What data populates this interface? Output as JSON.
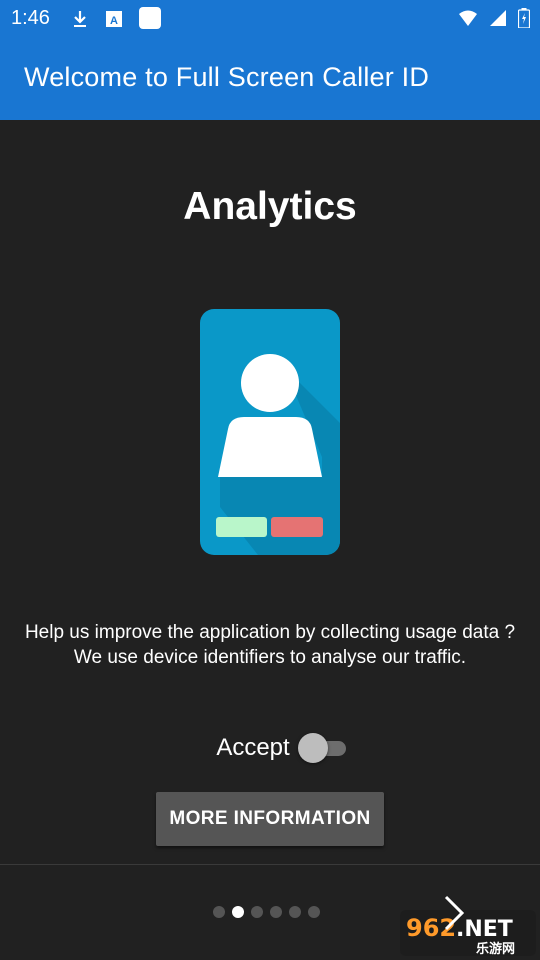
{
  "status_bar": {
    "time": "1:46",
    "icons": [
      "download-icon",
      "a-notification-icon",
      "app-square-icon",
      "wifi-icon",
      "cell-signal-icon",
      "battery-icon"
    ]
  },
  "app_bar": {
    "title": "Welcome to Full Screen Caller ID",
    "color": "#1976d2"
  },
  "onboarding": {
    "title": "Analytics",
    "illustration": "phone-caller-illustration",
    "description": "Help us improve the application by collecting usage data ? We use device identifiers to analyse our traffic.",
    "accept_label": "Accept",
    "accept_toggle_on": false,
    "more_info_label": "MORE INFORMATION",
    "page_indicator": {
      "count": 6,
      "current": 2
    }
  },
  "watermark": {
    "text": "962.NET",
    "subtext": "乐游网"
  },
  "colors": {
    "background": "#212121",
    "phone_body": "#0a98c8",
    "accept_call": "#b9f6ca",
    "decline_call": "#e57373"
  }
}
